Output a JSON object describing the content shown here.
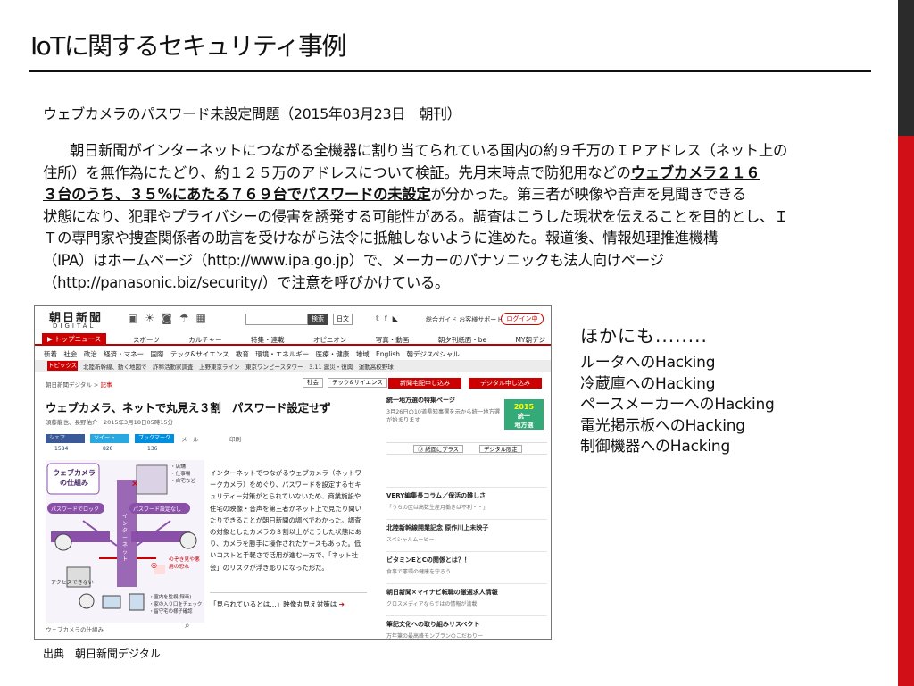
{
  "slide": {
    "title": "IoTに関するセキュリティ事例",
    "article_head": "ウェブカメラのパスワード未設定問題（2015年03月23日　朝刊）",
    "body_lines": [
      "朝日新聞がインターネットにつながる全機器に割り当てられている国内の約９千万のＩＰアドレス（ネット上の",
      "住所）を無作為にたどり、約１２５万のアドレスについて検証。先月末時点で防犯用などの",
      "ウェブカメラ２１６",
      "３台のうち、３５%にあたる７６９台でパスワードの未設定",
      "が分かった。第三者が映像や音声を見聞きできる",
      "状態になり、犯罪やプライバシーの侵害を誘発する可能性がある。調査はこうした現状を伝えることを目的とし、Ｉ",
      "Ｔの専門家や捜査関係者の助言を受けながら法令に抵触しないように進めた。報道後、情報処理推進機構",
      "（IPA）はホームページ（http://www.ipa.go.jp）で、メーカーのパナソニックも法人向けページ",
      "（http://panasonic.biz/security/）で注意を呼びかけている。"
    ],
    "source": "出典　朝日新聞デジタル",
    "other_head": "ほかにも........",
    "other_items": [
      "ルータへのHacking",
      "冷蔵庫へのHacking",
      "ペースメーカーへのHacking",
      "電光掲示板へのHacking",
      "制御機器へのHacking"
    ]
  },
  "screenshot": {
    "logo": "朝日新聞",
    "logo_sub": "DIGITAL",
    "search_button": "検索",
    "date_button": "日文",
    "top_links": "総合ガイド  お客様サポート",
    "login": "ログイン中",
    "nav_active": "▶ トップニュース",
    "nav_items": "スポーツ カルチャー 特集・連載 オピニオン 写真・動画 朝夕刊紙面・be MY朝デジ",
    "subnav": "新着  社会  政治  経済・マネー  国際  テック&サイエンス  教育  環境・エネルギー  医療・健康  地域  English  朝デジスペシャル",
    "tag_chip": "トピックス",
    "tag_text": "北陸新幹線、動く地図で　詐称活動家調査　上野東京ライン　東京ワンピースタワー　3.11 震災・復興　運動高校野球",
    "crumb_prefix": "朝日新聞デジタル  >  ",
    "crumb_current": "記事",
    "chip_society": "社会",
    "chip_tech": "テック&サイエンス",
    "btn_paper": "新聞宅配申し込み",
    "btn_digital": "デジタル申し込み",
    "headline": "ウェブカメラ、ネットで丸見え３割　パスワード設定せず",
    "byline": "須藤龍也、長野佑介　2015年3月18日05時15分",
    "share_fb": "シェア",
    "share_tw": "ツイート",
    "share_hb": "ブックマーク",
    "share_mail": "メール",
    "share_print": "印刷",
    "count_fb": "1584",
    "count_tw": "828",
    "count_hb": "136",
    "info_title": "ウェブカメラの仕組み",
    "info_lock": "パスワードでロック",
    "info_nolock": "パスワード設定なし",
    "info_access": "アクセスできない",
    "info_internet": "インターネット",
    "info_peek": "のぞき見や悪用の恐れ",
    "info_uses": "・店舗\n・仕事場\n・自宅など",
    "info_check": "・室内を監視(録画)\n・家の入り口をチェック\n・留守宅の様子確認",
    "info_caption": "ウェブカメラの仕組み",
    "article_text": "インターネットでつながるウェブカメラ（ネットワークカメラ）をめぐり、パスワードを設定するセキュリティー対策がとられていないため、商業施設や住宅の映像・音声を第三者がネット上で見たり聞いたりできることが朝日新聞の調べでわかった。調査の対象としたカメラの３割以上がこうした状態にあり、カメラを勝手に操作されたケースもあった。低いコストと手軽さで活用が進む一方で、「ネット社会」のリスクが浮き彫りになった形だ。",
    "see_more": "「見られているとは…」映像丸見え対策は",
    "see_more_arrow": "➔",
    "rc_title": "統一地方選の特集ページ",
    "rc_sub": "3月26日の10道県知事選を示から統一地方選が始まります",
    "rc_badge_year": "2015",
    "rc_badge_text": "統一\n地方選",
    "rc_btn1": "Ⓓ 紙面にプラス",
    "rc_btn2": "デジタル限定",
    "rc_items": [
      {
        "t": "VERY編集長コラム／保活の難しさ",
        "s": "「うちの区は高数生産月働きは不利・・」"
      },
      {
        "t": "北陸新幹線開業記念  原作川上未映子",
        "s": "スペシャルムービー"
      },
      {
        "t": "ビタミンEとCの関係とは？！",
        "s": "食事で悪環の健康を守ろう"
      },
      {
        "t": "朝日新聞×マイナビ転職の厳選求人情報",
        "s": "クロスメディアならではの情報が満載"
      },
      {
        "t": "筆記文化への取り組みリスペクト",
        "s": "万年筆の最高峰モンブランのこだわり一"
      }
    ]
  },
  "colors": {
    "accent_red": "#d10f16",
    "dark_bar": "#2b2b2b",
    "purple": "#8a4fa8"
  }
}
